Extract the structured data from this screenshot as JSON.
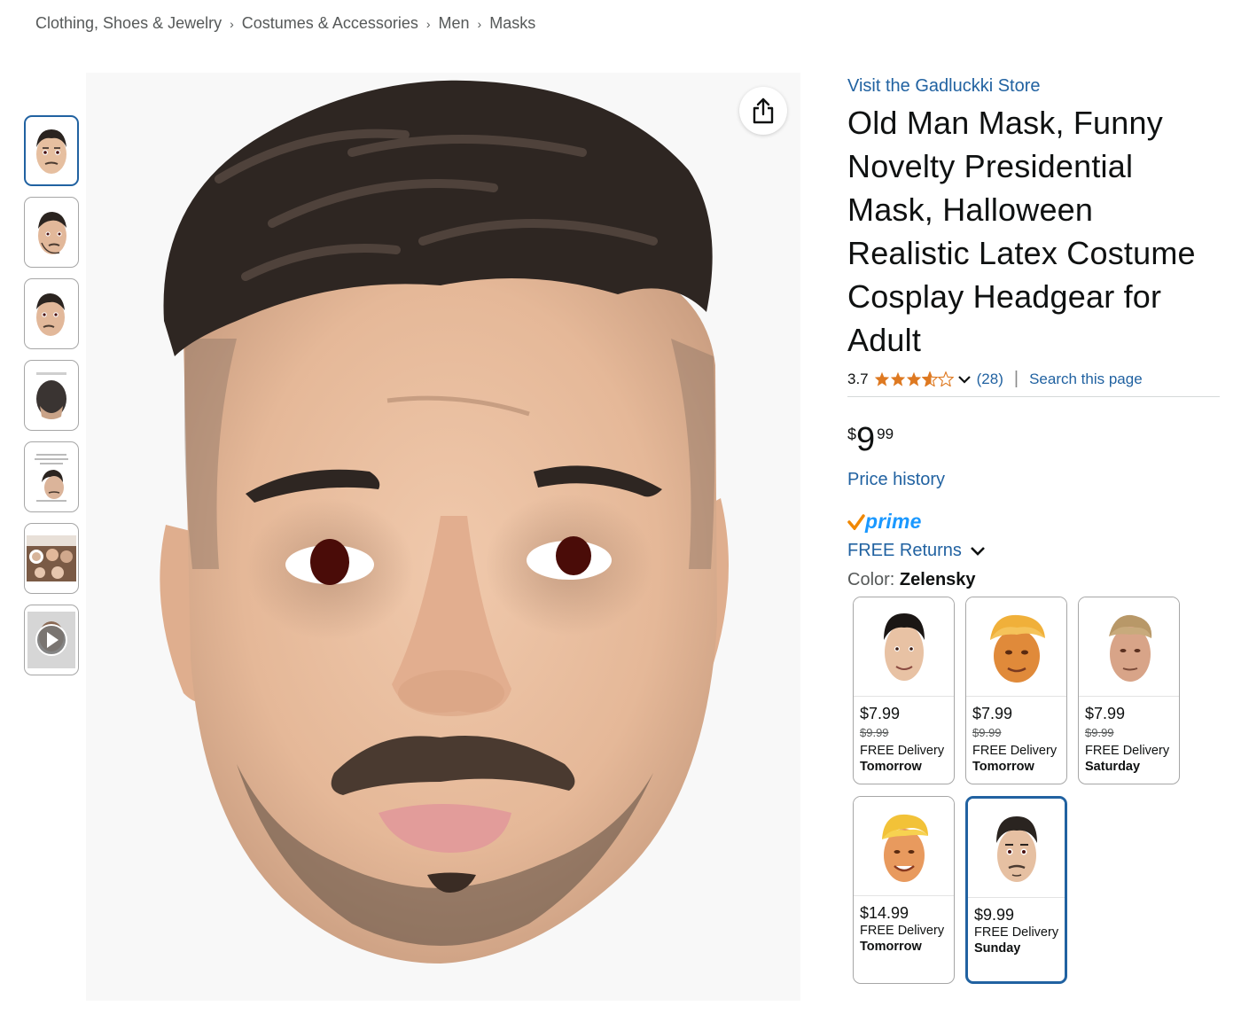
{
  "breadcrumb": [
    "Clothing, Shoes & Jewelry",
    "Costumes & Accessories",
    "Men",
    "Masks"
  ],
  "product": {
    "store_link": "Visit the Gadluckki Store",
    "title": "Old Man Mask, Funny Novelty Presidential Mask, Halloween Realistic Latex Costume Cosplay Headgear for Adult",
    "rating": "3.7",
    "rating_value": 3.7,
    "review_count": "(28)",
    "search_this_page": "Search this page",
    "price_symbol": "$",
    "price_whole": "9",
    "price_fraction": "99",
    "price_history": "Price history",
    "prime_label": "prime",
    "free_returns": "FREE Returns",
    "color_label": "Color:",
    "color_value": "Zelensky"
  },
  "thumbnails": [
    {
      "icon": "face-thumbnail-front",
      "selected": true
    },
    {
      "icon": "face-thumbnail-side",
      "selected": false
    },
    {
      "icon": "face-thumbnail-angle",
      "selected": false
    },
    {
      "icon": "back-of-head-thumbnail",
      "selected": false
    },
    {
      "icon": "size-chart-thumbnail",
      "selected": false
    },
    {
      "icon": "collage-thumbnail",
      "selected": false
    },
    {
      "icon": "video-play-thumbnail",
      "selected": false
    }
  ],
  "swatches": [
    {
      "price": "$7.99",
      "old_price": "$9.99",
      "delivery": "FREE Delivery",
      "day": "Tomorrow",
      "icon": "dark-hair-mask-icon",
      "selected": false
    },
    {
      "price": "$7.99",
      "old_price": "$9.99",
      "delivery": "FREE Delivery",
      "day": "Tomorrow",
      "icon": "orange-mask-icon",
      "selected": false
    },
    {
      "price": "$7.99",
      "old_price": "$9.99",
      "delivery": "FREE Delivery",
      "day": "Saturday",
      "icon": "old-man-mask-icon",
      "selected": false
    },
    {
      "price": "$14.99",
      "delivery": "FREE Delivery",
      "day": "Tomorrow",
      "icon": "blonde-mask-icon",
      "selected": false
    },
    {
      "price": "$9.99",
      "delivery": "FREE Delivery",
      "day": "Sunday",
      "icon": "zelensky-mask-icon",
      "selected": true
    }
  ],
  "colors": {
    "link": "#2162a1",
    "selected_border": "#2162a1",
    "star": "#de7921",
    "prime_check": "#f08804",
    "prime_text": "#1a98ff"
  }
}
